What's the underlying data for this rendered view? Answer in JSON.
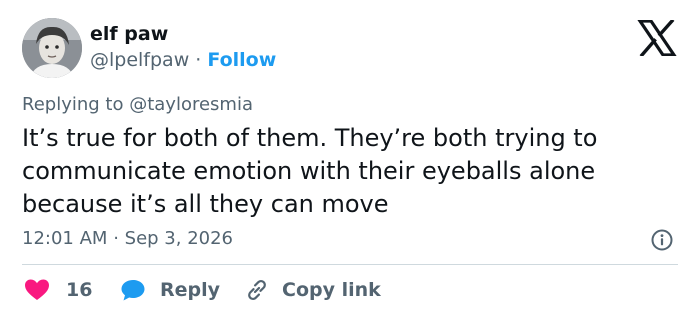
{
  "author": {
    "name": "elf paw",
    "handle": "@lpelfpaw",
    "separator": "·",
    "follow_label": "Follow"
  },
  "reply_context": {
    "prefix": "Replying to ",
    "mention": "@tayloresmia"
  },
  "tweet": {
    "text": "It’s true for both of them. They’re both trying to communicate emotion with their eyeballs alone because it’s all they can move",
    "time": "12:01 AM",
    "separator": "·",
    "date": "Sep 3, 2026"
  },
  "actions": {
    "like_count": "16",
    "reply_label": "Reply",
    "copy_label": "Copy link"
  },
  "colors": {
    "accent": "#1d9bf0",
    "like": "#f91880",
    "muted": "#536471",
    "text": "#0f1419"
  },
  "icons": [
    "x-logo-icon",
    "info-icon",
    "heart-icon",
    "speech-bubble-icon",
    "link-icon"
  ]
}
